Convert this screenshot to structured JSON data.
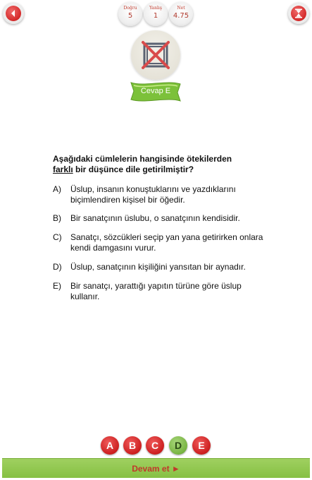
{
  "stats": {
    "correct": {
      "label": "Doğru",
      "value": "5"
    },
    "wrong": {
      "label": "Yanlış",
      "value": "1"
    },
    "net": {
      "label": "Net",
      "value": "4.75"
    }
  },
  "answer_banner": "Cevap E",
  "question": {
    "part1": "Aşağıdaki cümlelerin hangisinde ötekilerden",
    "underlined": "farklı",
    "part2": " bir düşünce dile getirilmiştir?"
  },
  "options": [
    {
      "letter": "A)",
      "text": "Üslup, insanın konuştuklarını ve yazdıklarını biçimlendiren kişisel bir öğedir."
    },
    {
      "letter": "B)",
      "text": "Bir sanatçının üslubu, o sanatçının kendisidir."
    },
    {
      "letter": "C)",
      "text": "Sanatçı, sözcükleri seçip yan yana getirirken onlara kendi damgasını vurur."
    },
    {
      "letter": "D)",
      "text": "Üslup, sanatçının kişiliğini yansıtan bir aynadır."
    },
    {
      "letter": "E)",
      "text": "Bir sanatçı, yarattığı yapıtın türüne göre üslup kullanır."
    }
  ],
  "answer_buttons": [
    "A",
    "B",
    "C",
    "D",
    "E"
  ],
  "continue_label": "Devam et ►",
  "colors": {
    "accent_red": "#cc1f1f",
    "accent_green": "#86c043"
  },
  "icons": {
    "back": "back-arrow-icon",
    "exit": "hourglass-icon",
    "result": "wrong-cross-icon"
  }
}
